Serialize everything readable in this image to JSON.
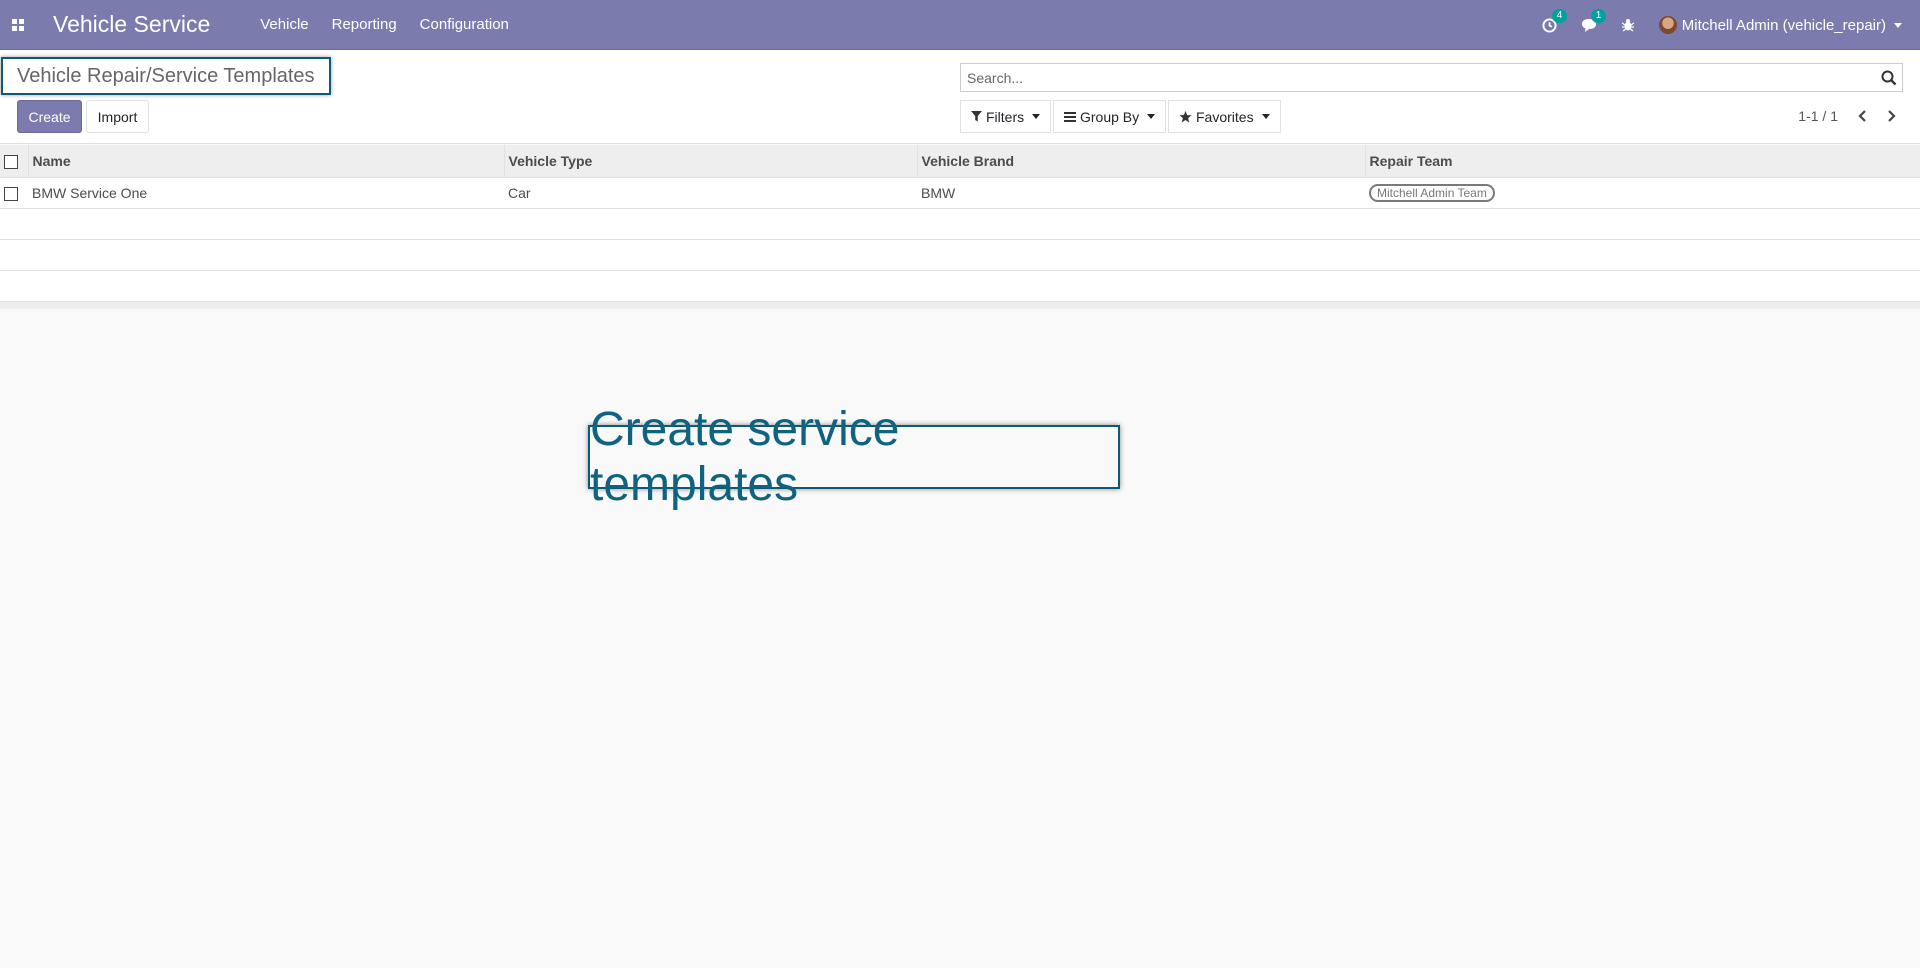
{
  "navbar": {
    "brand": "Vehicle Service",
    "menu": [
      "Vehicle",
      "Reporting",
      "Configuration"
    ],
    "activity_count": "4",
    "messages_count": "1",
    "user": "Mitchell Admin (vehicle_repair)"
  },
  "control_panel": {
    "breadcrumb": "Vehicle Repair/Service Templates",
    "create_label": "Create",
    "import_label": "Import",
    "search_placeholder": "Search...",
    "filters_label": "Filters",
    "groupby_label": "Group By",
    "favorites_label": "Favorites",
    "pager": "1-1 / 1"
  },
  "table": {
    "columns": [
      "Name",
      "Vehicle Type",
      "Vehicle Brand",
      "Repair Team"
    ],
    "rows": [
      {
        "name": "BMW Service One",
        "vehicle_type": "Car",
        "vehicle_brand": "BMW",
        "repair_team": "Mitchell Admin Team"
      }
    ]
  },
  "tooltip": "Create service templates"
}
